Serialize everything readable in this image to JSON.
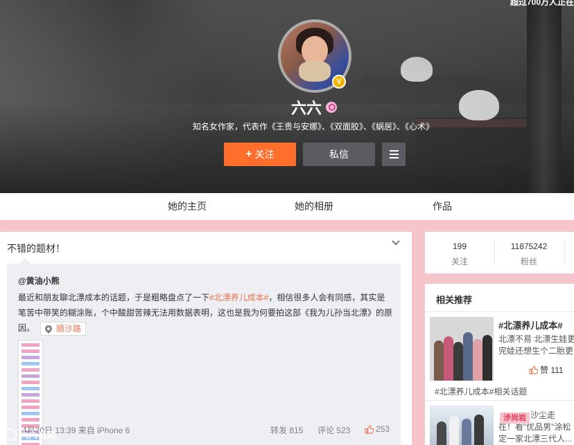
{
  "header": {
    "top_banner": "超过700万人正在",
    "name": "六六",
    "intro": "知名女作家，代表作《王贵与安娜》、《双面胶》、《蜗居》、《心术》",
    "follow_label": "关注",
    "message_label": "私信",
    "colors": {
      "follow": "#ff6e2a",
      "secondary_button": "#5a5c62",
      "page_bg": "#f6c5cc"
    }
  },
  "nav": {
    "tabs": [
      {
        "label": "她的主页"
      },
      {
        "label": "她的相册"
      },
      {
        "label": "作品"
      }
    ]
  },
  "post": {
    "text": "不错的题材！",
    "quoted": {
      "user": "@黄油小熊",
      "body_before": "最近和朋友聊北漂成本的话题，于是粗略盘点了一下",
      "topic": "#北漂养儿成本#",
      "body_after": "，相信很多人会有同感，其实是笔苦中带笑的糊涂账，个中酸甜苦辣无法用数据表明，这也是我为何要拍这部《我为儿孙当北漂》的原因。",
      "location": "顺沙路"
    },
    "time": "4月20日 13:39 来自 iPhone 6",
    "repost": "转发 815",
    "comment": "评论 523",
    "likes": "253",
    "watermark": "六六视频"
  },
  "stats": {
    "following_count": "199",
    "following_label": "关注",
    "fans_count": "11875242",
    "fans_label": "粉丝"
  },
  "recommend": {
    "title": "相关推荐",
    "topic": "#北漂养儿成本#",
    "desc_line1": "北漂不易 北漂生娃更",
    "desc_line2": "完娃还想生个二胎更",
    "likes": "赞 111",
    "footer": "#北漂养儿成本#相关话题",
    "badge": "涉尚岩",
    "desc2_line1": "沙尘走",
    "desc2_line2": "在！看\"优品男\"涂松",
    "desc2_line3": "定一家北漂三代人..."
  }
}
